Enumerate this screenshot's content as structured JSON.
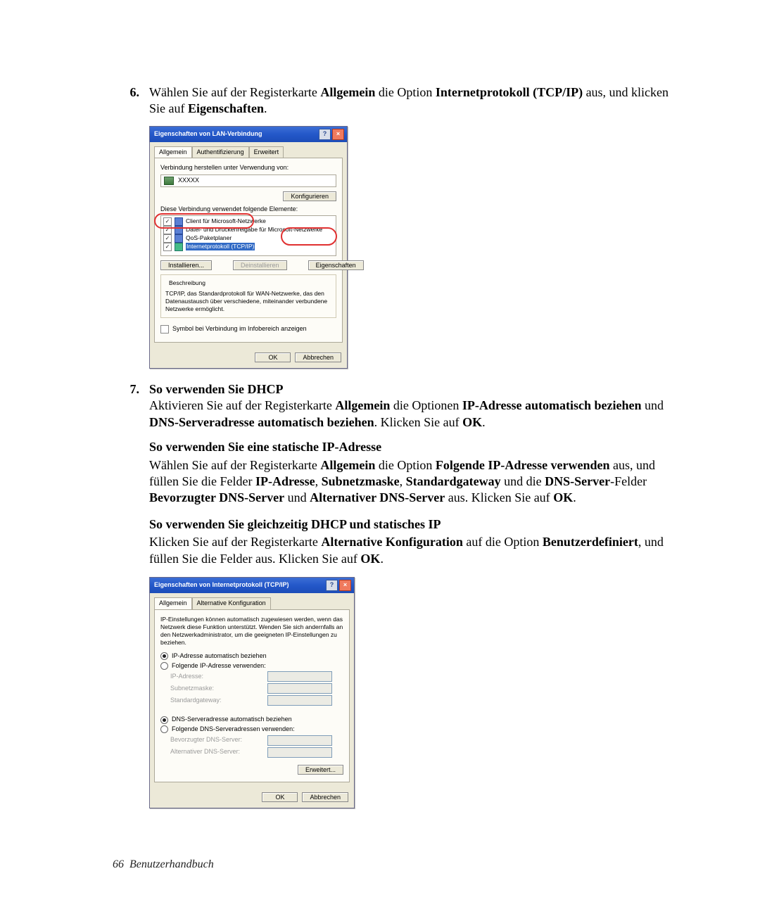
{
  "step6": {
    "number": "6.",
    "text_pre": "Wählen Sie auf der Registerkarte ",
    "tab": "Allgemein",
    "text_mid": " die Option ",
    "proto": "Internetprotokoll (TCP/IP)",
    "text_aft": " aus, und klicken Sie auf ",
    "action": "Eigenschaften",
    "period": "."
  },
  "dlg1": {
    "title": "Eigenschaften von LAN-Verbindung",
    "tabs": [
      "Allgemein",
      "Authentifizierung",
      "Erweitert"
    ],
    "conn_label": "Verbindung herstellen unter Verwendung von:",
    "adapter": "XXXXX",
    "configure": "Konfigurieren",
    "uses_label": "Diese Verbindung verwendet folgende Elemente:",
    "items": [
      "Client für Microsoft-Netzwerke",
      "Datei- und Druckerfreigabe für Microsoft-Netzwerke",
      "QoS-Paketplaner",
      "Internetprotokoll (TCP/IP)"
    ],
    "install": "Installieren...",
    "uninstall": "Deinstallieren",
    "props": "Eigenschaften",
    "desc_title": "Beschreibung",
    "desc_text": "TCP/IP, das Standardprotokoll für WAN-Netzwerke, das den Datenaustausch über verschiedene, miteinander verbundene Netzwerke ermöglicht.",
    "show_icon": "Symbol bei Verbindung im Infobereich anzeigen",
    "ok": "OK",
    "cancel": "Abbrechen"
  },
  "step7": {
    "number": "7.",
    "heading": "So verwenden Sie DHCP",
    "p1a": "Aktivieren Sie auf der Registerkarte ",
    "p1b": "Allgemein",
    "p1c": " die Optionen ",
    "p1d": "IP-Adresse automatisch beziehen",
    "p1e": " und ",
    "p1f": "DNS-Serveradresse automatisch beziehen",
    "p1g": ". Klicken Sie auf ",
    "p1h": "OK",
    "p1i": "."
  },
  "static": {
    "heading": "So verwenden Sie eine statische IP-Adresse",
    "a": "Wählen Sie auf der Registerkarte ",
    "b": "Allgemein",
    "c": " die Option ",
    "d": "Folgende IP-Adresse verwenden",
    "e": " aus, und füllen Sie die Felder ",
    "f": "IP-Adresse",
    "g": ", ",
    "h": "Subnetzmaske",
    "i": ", ",
    "j": "Standardgateway",
    "k": " und die ",
    "l": "DNS-Server",
    "m": "-Felder ",
    "n": "Bevorzugter DNS-Server",
    "o": " und ",
    "p": "Alternativer DNS-Server",
    "q": " aus. Klicken Sie auf ",
    "r": "OK",
    "s": "."
  },
  "both": {
    "heading": "So verwenden Sie gleichzeitig DHCP und statisches IP",
    "a": "Klicken Sie auf der Registerkarte ",
    "b": "Alternative Konfiguration",
    "c": " auf die Option ",
    "d": "Benutzerdefiniert",
    "e": ", und füllen Sie die Felder aus. Klicken Sie auf ",
    "f": "OK",
    "g": "."
  },
  "dlg2": {
    "title": "Eigenschaften von Internetprotokoll (TCP/IP)",
    "tabs": [
      "Allgemein",
      "Alternative Konfiguration"
    ],
    "intro": "IP-Einstellungen können automatisch zugewiesen werden, wenn das Netzwerk diese Funktion unterstützt. Wenden Sie sich andernfalls an den Netzwerkadministrator, um die geeigneten IP-Einstellungen zu beziehen.",
    "r1": "IP-Adresse automatisch beziehen",
    "r2": "Folgende IP-Adresse verwenden:",
    "ip": "IP-Adresse:",
    "mask": "Subnetzmaske:",
    "gw": "Standardgateway:",
    "r3": "DNS-Serveradresse automatisch beziehen",
    "r4": "Folgende DNS-Serveradressen verwenden:",
    "dns1": "Bevorzugter DNS-Server:",
    "dns2": "Alternativer DNS-Server:",
    "adv": "Erweitert...",
    "ok": "OK",
    "cancel": "Abbrechen"
  },
  "footer": {
    "page": "66",
    "title": "Benutzerhandbuch"
  }
}
